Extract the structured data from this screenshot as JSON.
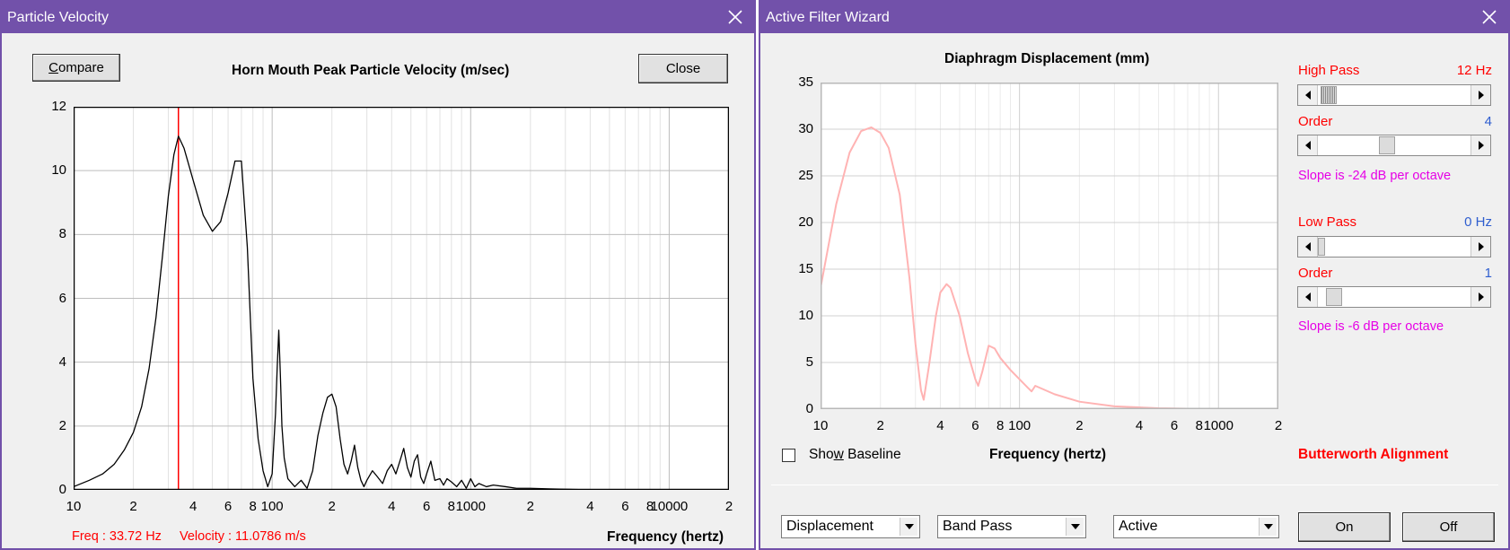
{
  "left_window": {
    "title": "Particle Velocity",
    "compare_button": {
      "prefix": "",
      "underlined": "C",
      "rest": "ompare"
    },
    "close_button": "Close",
    "chart_title": "Horn Mouth Peak Particle Velocity (m/sec)",
    "x_axis_label": "Frequency (hertz)",
    "status": {
      "freq": "Freq : 33.72 Hz",
      "velocity": "Velocity : 11.0786 m/s"
    }
  },
  "right_window": {
    "title": "Active Filter Wizard",
    "chart_title": "Diaphragm Displacement (mm)",
    "x_axis_label": "Frequency (hertz)",
    "show_baseline": {
      "prefix": "Sho",
      "underlined": "w",
      "rest": " Baseline",
      "checked": false
    },
    "high_pass": {
      "label": "High Pass",
      "value": "12 Hz",
      "slider_fraction": 0.02
    },
    "high_pass_order": {
      "label": "Order",
      "value": "4",
      "slider_fraction": 0.45
    },
    "high_pass_slope": "Slope is -24 dB per octave",
    "low_pass": {
      "label": "Low Pass",
      "value": "0 Hz",
      "slider_fraction": 0.0
    },
    "low_pass_order": {
      "label": "Order",
      "value": "1",
      "slider_fraction": 0.06
    },
    "low_pass_slope": "Slope is -6 dB per octave",
    "alignment": "Butterworth Alignment",
    "dropdowns": {
      "mode": "Displacement",
      "filter_type": "Band Pass",
      "filter_kind": "Active"
    },
    "on_button": "On",
    "off_button": "Off"
  },
  "colors": {
    "titlebar": "#7251aa",
    "velocity_curve": "#000000",
    "cursor_line": "#ff0000",
    "displacement_curve": "#ffb3b3",
    "status_text": "#ff0000"
  },
  "icons": {
    "close": "close-x-icon",
    "dropdown": "chevron-down-icon",
    "scroll_left": "arrow-left-icon",
    "scroll_right": "arrow-right-icon"
  },
  "chart_data": [
    {
      "type": "line",
      "title": "Horn Mouth Peak Particle Velocity (m/sec)",
      "xlabel": "Frequency (hertz)",
      "ylabel": "",
      "x_scale": "log",
      "xlim": [
        10,
        20000
      ],
      "ylim": [
        0,
        12
      ],
      "y_ticks": [
        0,
        2,
        4,
        6,
        8,
        10,
        12
      ],
      "x_tick_values": [
        10,
        20,
        40,
        60,
        80,
        100,
        200,
        400,
        600,
        800,
        1000,
        2000,
        4000,
        6000,
        8000,
        10000,
        20000
      ],
      "x_tick_labels": [
        "10",
        "2",
        "4",
        "6",
        "8",
        "100",
        "2",
        "4",
        "6",
        "8",
        "1000",
        "2",
        "4",
        "6",
        "8",
        "10000",
        "2"
      ],
      "grid": true,
      "cursor_x": 33.72,
      "series": [
        {
          "x": [
            10,
            12,
            14,
            16,
            18,
            20,
            22,
            24,
            26,
            28,
            30,
            32,
            33.72,
            36,
            40,
            45,
            50,
            55,
            60,
            65,
            70,
            75,
            80,
            85,
            90,
            95,
            100,
            104,
            106,
            108,
            110,
            112,
            115,
            120,
            130,
            140,
            150,
            160,
            170,
            180,
            190,
            200,
            210,
            220,
            230,
            240,
            250,
            260,
            270,
            280,
            290,
            300,
            320,
            340,
            360,
            380,
            400,
            420,
            440,
            460,
            480,
            500,
            520,
            540,
            560,
            580,
            600,
            630,
            660,
            700,
            730,
            760,
            800,
            850,
            900,
            950,
            1000,
            1050,
            1100,
            1200,
            1300,
            1500,
            1700,
            2000,
            2500,
            3000,
            3500
          ],
          "y": [
            0.1,
            0.3,
            0.5,
            0.8,
            1.25,
            1.8,
            2.6,
            3.8,
            5.4,
            7.3,
            9.2,
            10.5,
            11.08,
            10.7,
            9.7,
            8.6,
            8.1,
            8.4,
            9.3,
            10.3,
            10.3,
            7.6,
            3.5,
            1.6,
            0.6,
            0.1,
            0.5,
            2.4,
            3.8,
            5.0,
            3.6,
            2.0,
            1.0,
            0.35,
            0.1,
            0.3,
            0.05,
            0.6,
            1.7,
            2.4,
            2.9,
            3.0,
            2.6,
            1.6,
            0.8,
            0.5,
            0.9,
            1.4,
            0.7,
            0.3,
            0.1,
            0.3,
            0.6,
            0.4,
            0.2,
            0.6,
            0.8,
            0.5,
            0.9,
            1.3,
            0.7,
            0.4,
            0.9,
            1.1,
            0.4,
            0.2,
            0.5,
            0.9,
            0.3,
            0.35,
            0.15,
            0.35,
            0.25,
            0.1,
            0.3,
            0.05,
            0.35,
            0.1,
            0.2,
            0.1,
            0.15,
            0.1,
            0.05,
            0.05,
            0.03,
            0.02,
            0.01
          ]
        }
      ]
    },
    {
      "type": "line",
      "title": "Diaphragm Displacement (mm)",
      "xlabel": "Frequency (hertz)",
      "ylabel": "",
      "x_scale": "log",
      "xlim": [
        10,
        2000
      ],
      "ylim": [
        0,
        35
      ],
      "y_ticks": [
        0,
        5,
        10,
        15,
        20,
        25,
        30,
        35
      ],
      "x_tick_values": [
        10,
        20,
        40,
        60,
        80,
        100,
        200,
        400,
        600,
        800,
        1000,
        2000
      ],
      "x_tick_labels": [
        "10",
        "2",
        "4",
        "6",
        "8",
        "100",
        "2",
        "4",
        "6",
        "8",
        "1000",
        "2"
      ],
      "grid": true,
      "series": [
        {
          "x": [
            10,
            12,
            14,
            16,
            18,
            20,
            22,
            25,
            28,
            30,
            32,
            33,
            35,
            38,
            40,
            43,
            45,
            50,
            55,
            60,
            62,
            65,
            70,
            75,
            80,
            90,
            100,
            110,
            115,
            120,
            150,
            200,
            300,
            500,
            700,
            800
          ],
          "y": [
            13.0,
            22.0,
            27.5,
            29.8,
            30.2,
            29.6,
            28.0,
            23.0,
            14.0,
            7.0,
            2.0,
            1.0,
            4.5,
            10.0,
            12.5,
            13.4,
            13.0,
            10.0,
            6.0,
            3.2,
            2.5,
            4.0,
            6.8,
            6.5,
            5.5,
            4.2,
            3.2,
            2.3,
            1.9,
            2.5,
            1.6,
            0.8,
            0.3,
            0.1,
            0.05,
            0.02
          ]
        }
      ]
    }
  ]
}
